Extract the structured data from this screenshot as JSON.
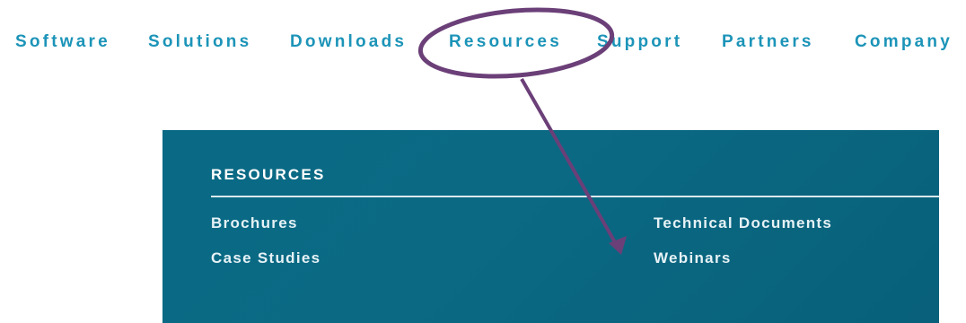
{
  "nav": {
    "items": [
      {
        "label": "Software"
      },
      {
        "label": "Solutions"
      },
      {
        "label": "Downloads"
      },
      {
        "label": "Resources"
      },
      {
        "label": "Support"
      },
      {
        "label": "Partners"
      },
      {
        "label": "Company"
      }
    ]
  },
  "dropdown": {
    "title": "RESOURCES",
    "links": [
      {
        "label": "Brochures"
      },
      {
        "label": "Case Studies"
      },
      {
        "label": "Technical Documents"
      },
      {
        "label": "Webinars"
      }
    ]
  },
  "colors": {
    "nav_text": "#1c94b8",
    "panel_bg": "#0a6a86",
    "panel_text": "#e6f2f6",
    "annotation": "#6b3f78"
  }
}
